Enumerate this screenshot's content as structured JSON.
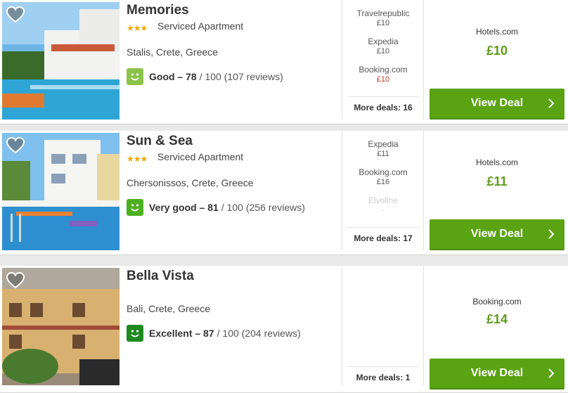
{
  "hotels": [
    {
      "name": "Memories",
      "stars": "★★★",
      "type": "Serviced Apartment",
      "location": "Stalis, Crete, Greece",
      "rating_label": "Good – 78",
      "rating_rest": "/ 100 (107 reviews)",
      "rating_color": "#8bc34a",
      "partners": [
        {
          "name": "Travelrepublic",
          "price": "£10",
          "style": ""
        },
        {
          "name": "Expedia",
          "price": "£10",
          "style": ""
        },
        {
          "name": "Booking.com",
          "price": "£10",
          "style": "red"
        }
      ],
      "more_deals": "More deals: 16",
      "best_site": "Hotels.com",
      "best_price": "£10",
      "deal_label": "View Deal"
    },
    {
      "name": "Sun & Sea",
      "stars": "★★★",
      "type": "Serviced Apartment",
      "location": "Chersonissos, Crete, Greece",
      "rating_label": "Very good – 81",
      "rating_rest": "/ 100 (256 reviews)",
      "rating_color": "#4caf1f",
      "partners": [
        {
          "name": "Expedia",
          "price": "£11",
          "style": ""
        },
        {
          "name": "Booking.com",
          "price": "£16",
          "style": ""
        },
        {
          "name": "Elvoline",
          "price": "-",
          "style": "faded"
        }
      ],
      "more_deals": "More deals: 17",
      "best_site": "Hotels.com",
      "best_price": "£11",
      "deal_label": "View Deal"
    },
    {
      "name": "Bella Vista",
      "stars": "",
      "type": "",
      "location": "Bali, Crete, Greece",
      "rating_label": "Excellent – 87",
      "rating_rest": "/ 100 (204 reviews)",
      "rating_color": "#1e8a1e",
      "partners": [],
      "more_deals": "More deals: 1",
      "best_site": "Booking.com",
      "best_price": "£14",
      "deal_label": "View Deal"
    }
  ],
  "icons": {
    "favorite": "heart-icon",
    "rating": "smiley-icon",
    "deal": "chevron-right-icon"
  },
  "colors": {
    "deal_button": "#5aa312",
    "price": "#5d9b18",
    "stars": "#f0a800"
  }
}
